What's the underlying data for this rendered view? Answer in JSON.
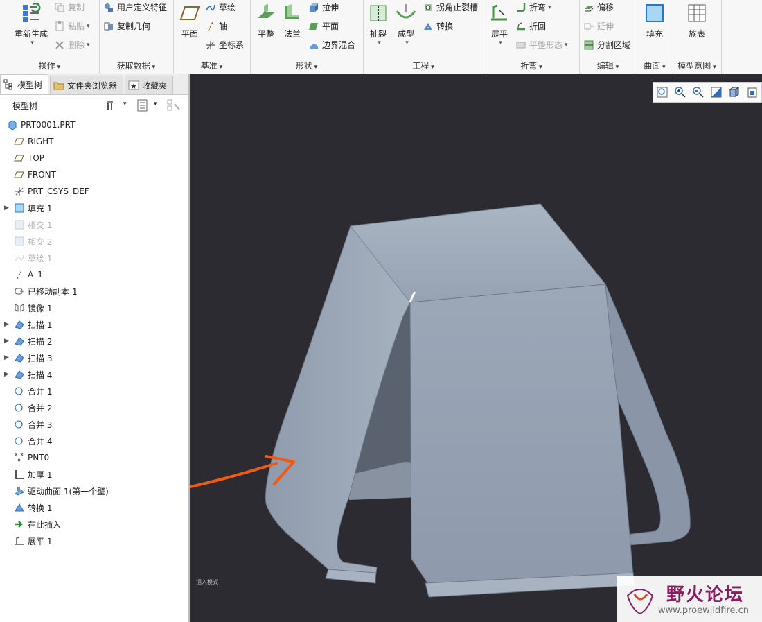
{
  "ribbon": {
    "operations": {
      "label": "操作",
      "regenerate": "重新生成",
      "copy": "复制",
      "paste": "粘贴",
      "delete": "删除"
    },
    "getdata": {
      "label": "获取数据",
      "udf": "用户定义特征",
      "copy_geom": "复制几何"
    },
    "datum": {
      "label": "基准",
      "plane": "平面",
      "sketch": "草绘",
      "axis": "轴",
      "csys": "坐标系"
    },
    "shape": {
      "label": "形状",
      "flat": "平整",
      "flange": "法兰",
      "extrude": "拉伸",
      "planar": "平面",
      "blend": "边界混合"
    },
    "engineering": {
      "label": "工程",
      "rip": "扯裂",
      "form": "成型",
      "corner_relief": "拐角止裂槽",
      "convert": "转换"
    },
    "bend": {
      "label": "折弯",
      "unbend": "展平",
      "bend": "折弯",
      "bendback": "折回",
      "flatten": "平整形态"
    },
    "edit": {
      "label": "编辑",
      "offset": "偏移",
      "extend": "延伸",
      "split": "分割区域"
    },
    "surface": {
      "label": "曲面",
      "fill": "填充"
    },
    "model_intent": {
      "label": "模型意图",
      "family_table": "族表"
    }
  },
  "tabs": [
    "模型树",
    "文件夹浏览器",
    "收藏夹"
  ],
  "tree_header": "模型树",
  "tree": [
    {
      "label": "PRT0001.PRT",
      "icon": "part-icon",
      "exp": false,
      "gray": false,
      "indent": 0
    },
    {
      "label": "RIGHT",
      "icon": "datum-plane-icon",
      "exp": false,
      "gray": false
    },
    {
      "label": "TOP",
      "icon": "datum-plane-icon",
      "exp": false,
      "gray": false
    },
    {
      "label": "FRONT",
      "icon": "datum-plane-icon",
      "exp": false,
      "gray": false
    },
    {
      "label": "PRT_CSYS_DEF",
      "icon": "csys-icon",
      "exp": false,
      "gray": false
    },
    {
      "label": "填充 1",
      "icon": "fill-icon",
      "exp": true,
      "gray": false
    },
    {
      "label": "相交 1",
      "icon": "intersect-icon",
      "exp": false,
      "gray": true
    },
    {
      "label": "相交 2",
      "icon": "intersect-icon",
      "exp": false,
      "gray": true
    },
    {
      "label": "草绘 1",
      "icon": "sketch-icon",
      "exp": false,
      "gray": true
    },
    {
      "label": "A_1",
      "icon": "axis-icon",
      "exp": false,
      "gray": false
    },
    {
      "label": "已移动副本 1",
      "icon": "moved-copy-icon",
      "exp": false,
      "gray": false
    },
    {
      "label": "镜像 1",
      "icon": "mirror-icon",
      "exp": false,
      "gray": false
    },
    {
      "label": "扫描 1",
      "icon": "sweep-icon",
      "exp": true,
      "gray": false
    },
    {
      "label": "扫描 2",
      "icon": "sweep-icon",
      "exp": true,
      "gray": false
    },
    {
      "label": "扫描 3",
      "icon": "sweep-icon",
      "exp": true,
      "gray": false
    },
    {
      "label": "扫描 4",
      "icon": "sweep-icon",
      "exp": true,
      "gray": false
    },
    {
      "label": "合并 1",
      "icon": "merge-icon",
      "exp": false,
      "gray": false
    },
    {
      "label": "合并 2",
      "icon": "merge-icon",
      "exp": false,
      "gray": false
    },
    {
      "label": "合并 3",
      "icon": "merge-icon",
      "exp": false,
      "gray": false
    },
    {
      "label": "合并 4",
      "icon": "merge-icon",
      "exp": false,
      "gray": false
    },
    {
      "label": "PNT0",
      "icon": "point-icon",
      "exp": false,
      "gray": false
    },
    {
      "label": "加厚 1",
      "icon": "thicken-icon",
      "exp": false,
      "gray": false
    },
    {
      "label": "驱动曲面 1(第一个壁)",
      "icon": "driving-surface-icon",
      "exp": false,
      "gray": false
    },
    {
      "label": "转换 1",
      "icon": "convert-icon",
      "exp": false,
      "gray": false
    },
    {
      "label": "在此插入",
      "icon": "insert-here-icon",
      "exp": false,
      "gray": false
    },
    {
      "label": "展平 1",
      "icon": "unbend-icon",
      "exp": false,
      "gray": false
    }
  ],
  "viewport": {
    "small_text": "插入模式",
    "annotation": "3",
    "watermark_title": "野火论坛",
    "watermark_url": "www.proewildfire.cn"
  },
  "colors": {
    "viewport_bg": "#2b2b31",
    "model": "#9aa6b5",
    "annotation": "#f05a12",
    "watermark": "#8b1c5f"
  }
}
